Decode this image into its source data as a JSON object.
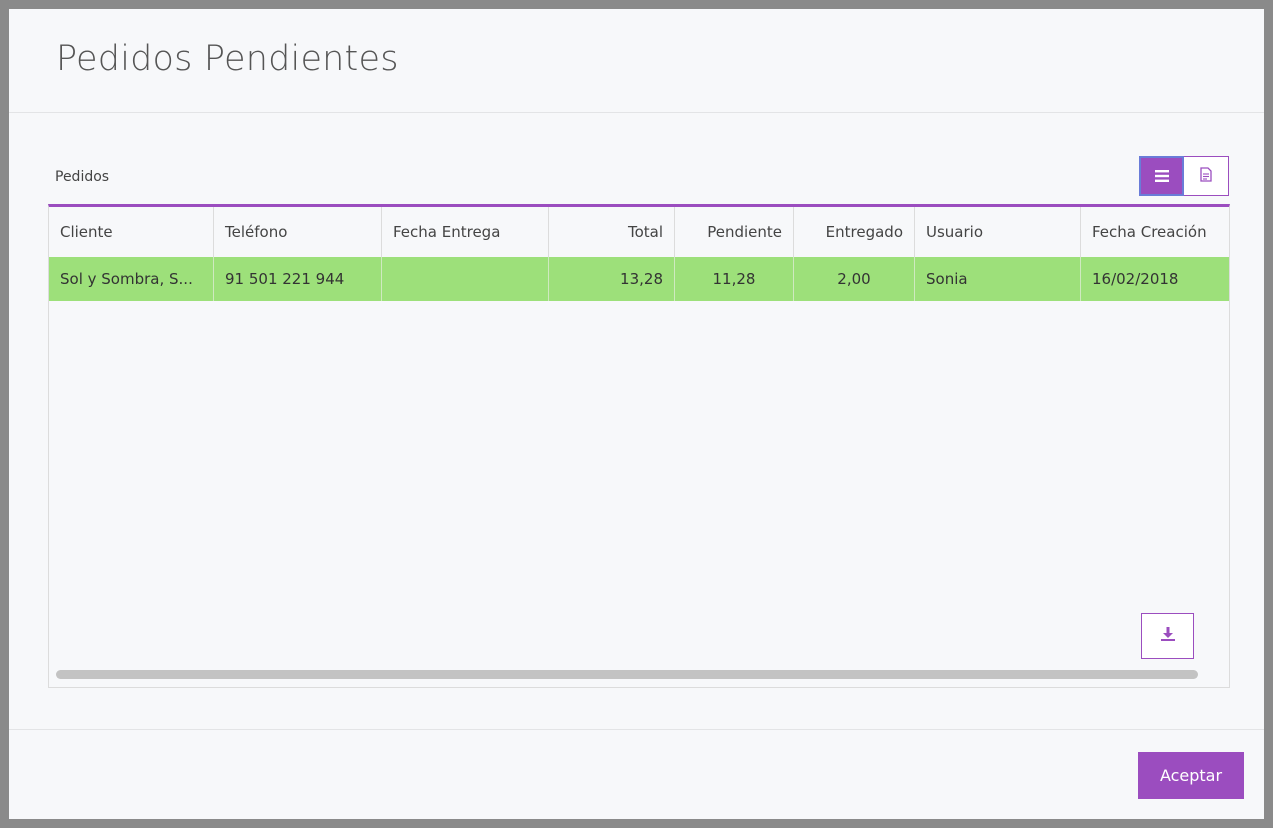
{
  "dialog": {
    "title": "Pedidos Pendientes"
  },
  "section": {
    "label": "Pedidos"
  },
  "colors": {
    "accent": "#9b4dbf",
    "row_highlight": "#9de07a"
  },
  "view_toggle": {
    "options": [
      {
        "icon": "list-icon",
        "active": true
      },
      {
        "icon": "document-icon",
        "active": false
      }
    ]
  },
  "table": {
    "columns": [
      "Cliente",
      "Teléfono",
      "Fecha Entrega",
      "Total",
      "Pendiente",
      "Entregado",
      "Usuario",
      "Fecha Creación"
    ],
    "rows": [
      {
        "cells": [
          "Sol y Sombra, S...",
          "91 501 221 944",
          "",
          "13,28",
          "11,28",
          "2,00",
          "Sonia",
          "16/02/2018"
        ],
        "highlighted": true
      }
    ]
  },
  "export": {
    "icon": "download-icon"
  },
  "footer": {
    "accept_label": "Aceptar"
  }
}
